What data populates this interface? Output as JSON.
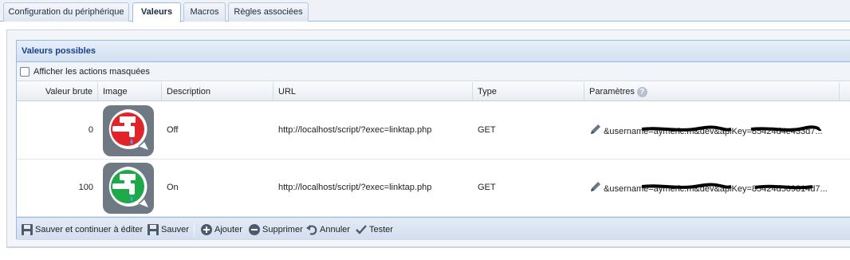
{
  "tabs": [
    {
      "label": "Configuration du périphérique",
      "active": false
    },
    {
      "label": "Valeurs",
      "active": true
    },
    {
      "label": "Macros",
      "active": false
    },
    {
      "label": "Règles associées",
      "active": false
    }
  ],
  "panel": {
    "title": "Valeurs possibles",
    "show_hidden_label": "Afficher les actions masquées",
    "show_hidden_checked": false
  },
  "grid": {
    "columns": [
      "Valeur brute",
      "Image",
      "Description",
      "URL",
      "Type",
      "Paramètres"
    ],
    "rows": [
      {
        "value": "0",
        "image_icon": "water-tap-red-icon",
        "image_color": "#e0242a",
        "description": "Off",
        "url": "http://localhost/script/?exec=linktap.php",
        "type": "GET",
        "params": "&username=aymeric.m&dev&apiKey=85424d4e433d7..."
      },
      {
        "value": "100",
        "image_icon": "water-tap-green-icon",
        "image_color": "#1ea84a",
        "description": "On",
        "url": "http://localhost/script/?exec=linktap.php",
        "type": "GET",
        "params": "&username=aymeric.m&dev&apiKey=85424d509814d7..."
      }
    ]
  },
  "toolbar": {
    "save_continue": "Sauver et continuer à éditer",
    "save": "Sauver",
    "add": "Ajouter",
    "delete": "Supprimer",
    "cancel": "Annuler",
    "test": "Tester"
  },
  "colors": {
    "header_blue": "#15428b",
    "border_blue": "#99bbe8"
  }
}
